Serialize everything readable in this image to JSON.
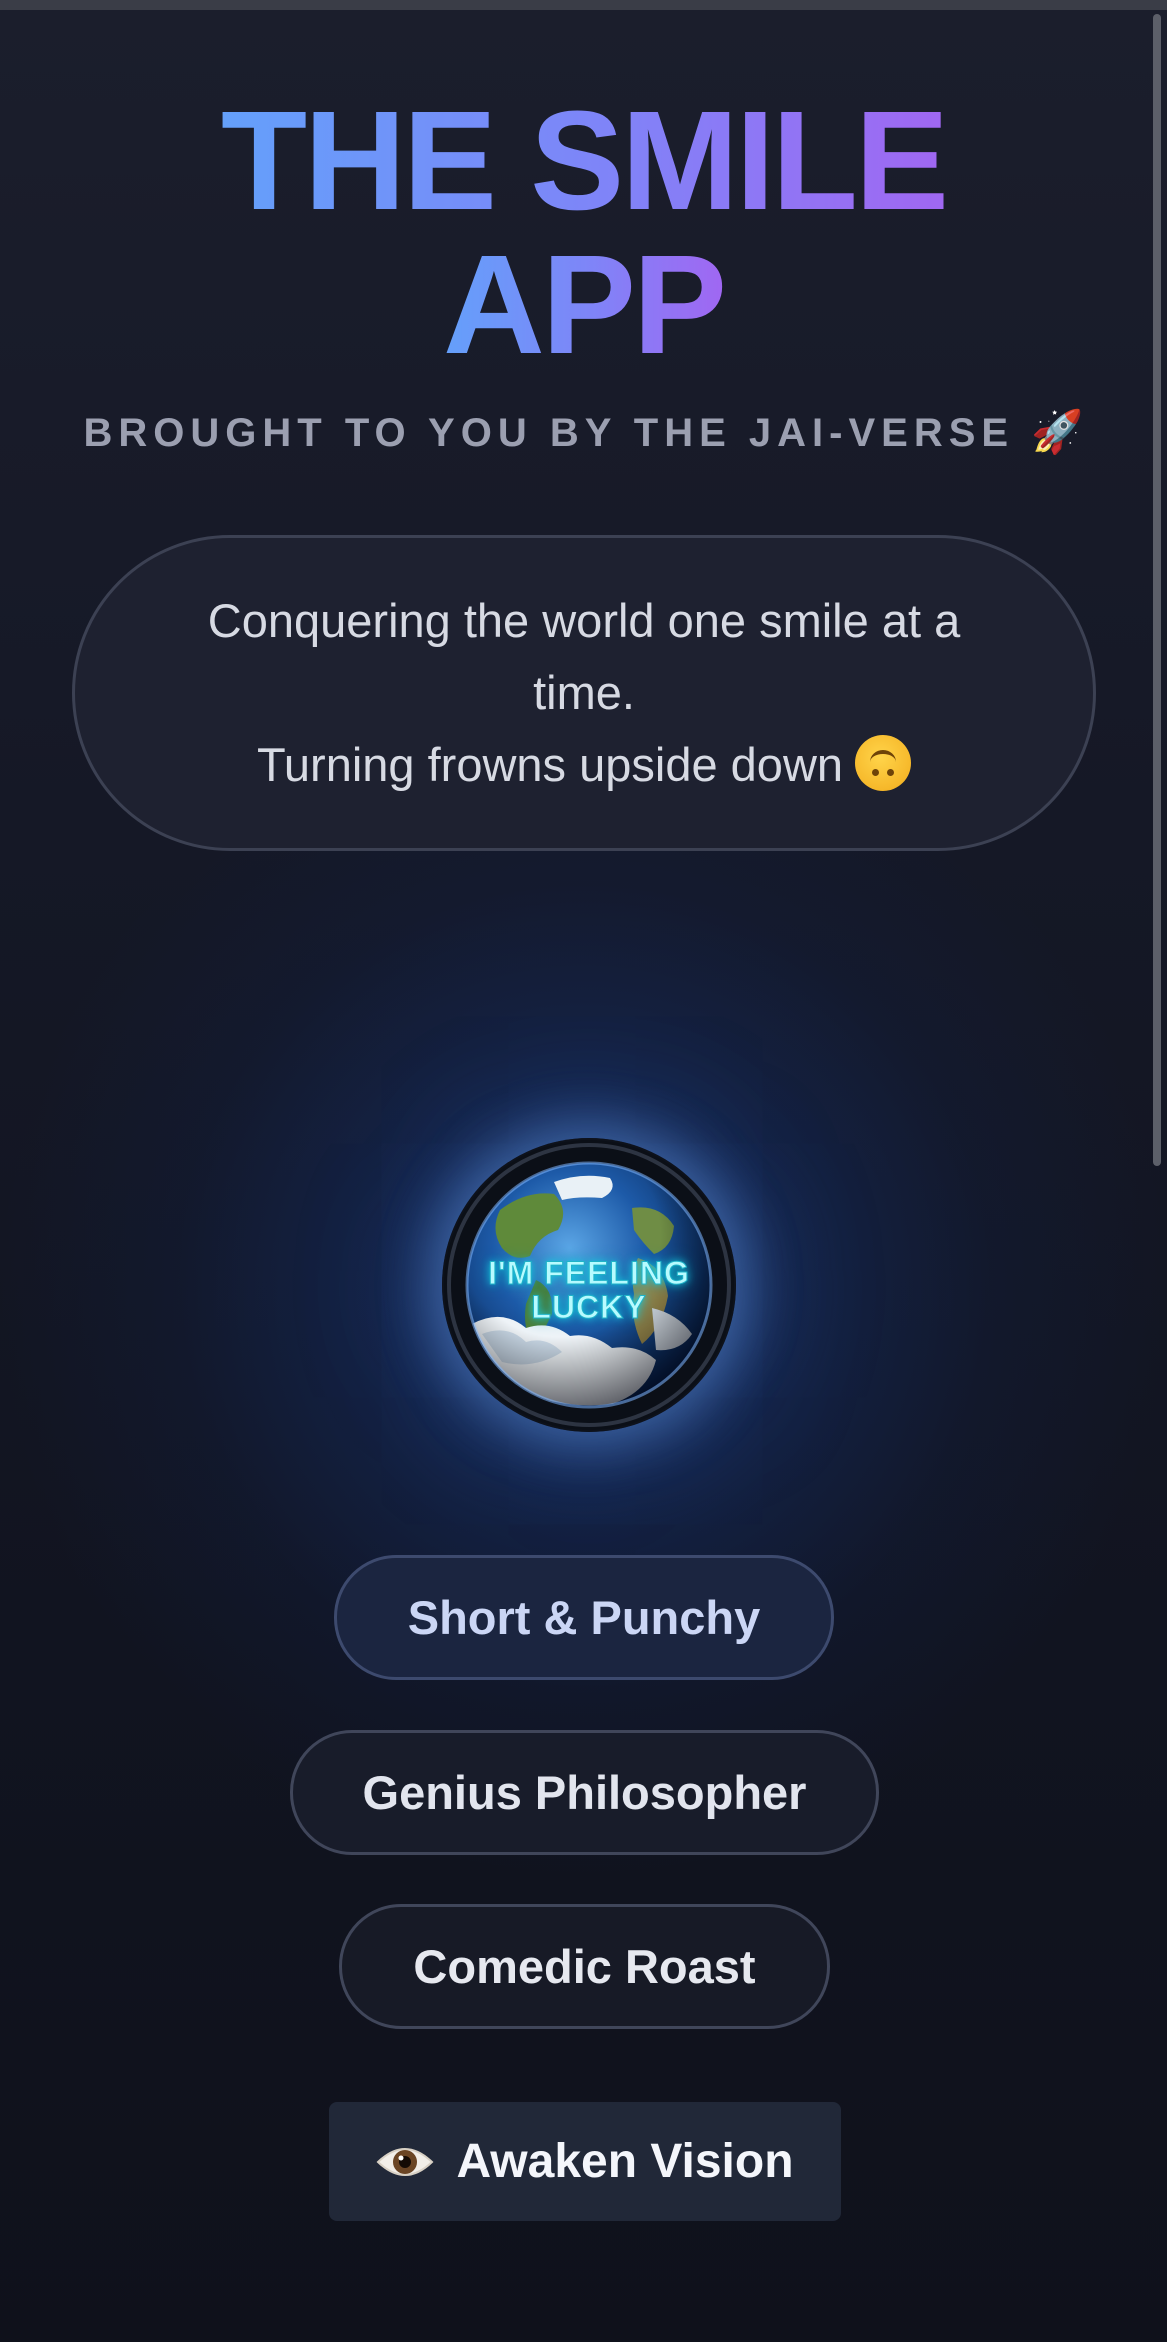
{
  "app": {
    "title_line1": "THE SMILE",
    "title_line2": "APP",
    "subtitle": "BROUGHT TO YOU BY THE JAI-VERSE",
    "subtitle_emoji": "🚀"
  },
  "tagline": {
    "line1": "Conquering the world one smile at a time.",
    "line2": "Turning frowns upside down"
  },
  "globe": {
    "label_line1": "I'M FEELING",
    "label_line2": "LUCKY",
    "icon": "earth-globe-icon"
  },
  "modes": [
    {
      "label": "Short & Punchy"
    },
    {
      "label": "Genius Philosopher"
    },
    {
      "label": "Comedic Roast"
    }
  ],
  "vision_button": {
    "label": "Awaken Vision",
    "icon": "eye-icon"
  },
  "colors": {
    "background": "#12141f",
    "title_gradient_start": "#64a0fa",
    "title_gradient_end": "#a067f2",
    "subtitle_text": "#9b9fb0",
    "card_background": "#1e2130",
    "card_border": "#3c4153",
    "glow": "#183c84",
    "neon_text": "#b7fbff",
    "selected_pill": "#1b2540",
    "vision_button": "#212838"
  }
}
